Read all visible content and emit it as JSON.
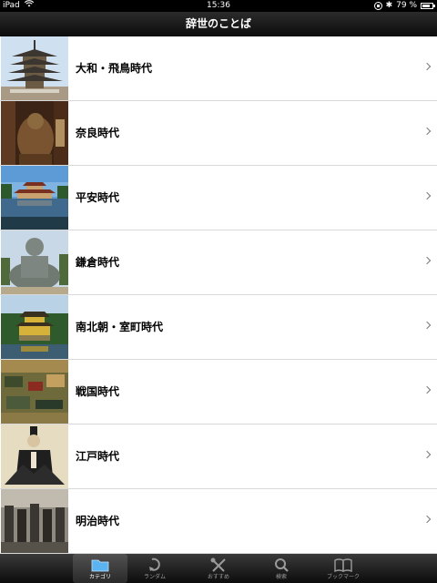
{
  "status_bar": {
    "device": "iPad",
    "time": "15:36",
    "battery": "79 %",
    "battery_level": 0.79
  },
  "nav": {
    "title": "辞世のことば"
  },
  "list": {
    "items": [
      {
        "label": "大和・飛鳥時代",
        "thumb": "pagoda-image"
      },
      {
        "label": "奈良時代",
        "thumb": "buddha-statue-image"
      },
      {
        "label": "平安時代",
        "thumb": "temple-pond-image"
      },
      {
        "label": "鎌倉時代",
        "thumb": "great-buddha-image"
      },
      {
        "label": "南北朝・室町時代",
        "thumb": "golden-pavilion-image"
      },
      {
        "label": "戦国時代",
        "thumb": "battle-painting-image"
      },
      {
        "label": "江戸時代",
        "thumb": "samurai-portrait-image"
      },
      {
        "label": "明治時代",
        "thumb": "meiji-photo-image"
      }
    ]
  },
  "tabs": [
    {
      "label": "カテゴリ",
      "icon": "folder-icon",
      "active": true
    },
    {
      "label": "ランダム",
      "icon": "refresh-icon",
      "active": false
    },
    {
      "label": "おすすめ",
      "icon": "utensils-icon",
      "active": false
    },
    {
      "label": "検索",
      "icon": "search-icon",
      "active": false
    },
    {
      "label": "ブックマーク",
      "icon": "book-icon",
      "active": false
    }
  ]
}
